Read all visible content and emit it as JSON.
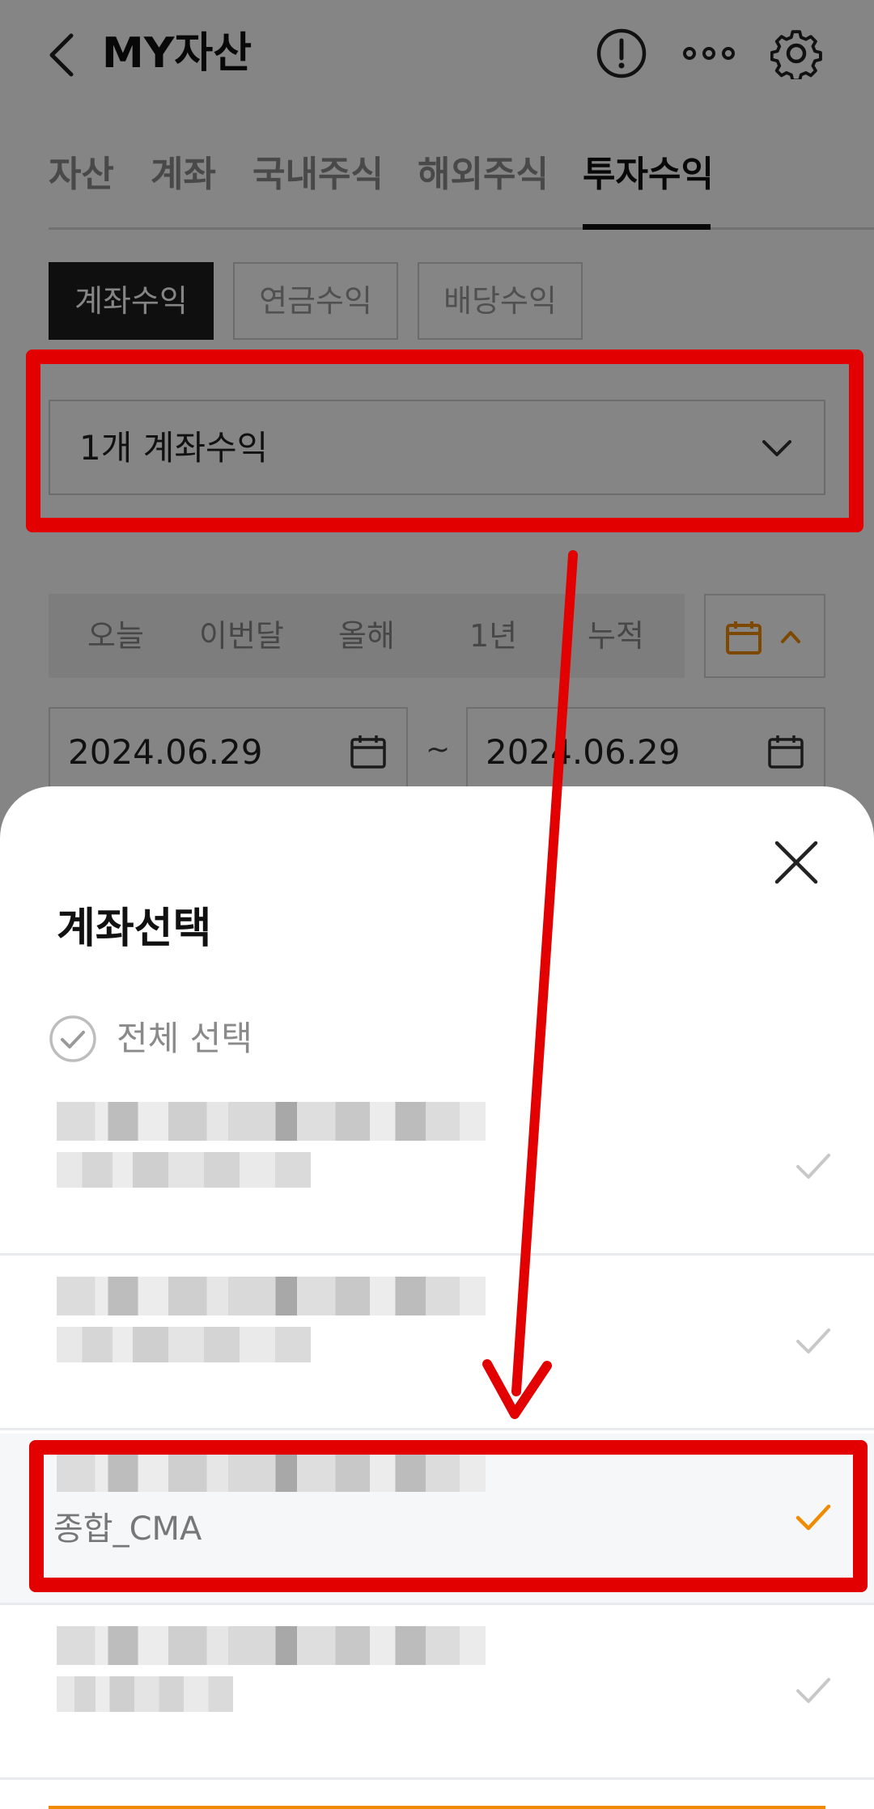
{
  "header": {
    "title": "MY자산"
  },
  "tabs": [
    "자산",
    "계좌",
    "국내주식",
    "해외주식",
    "투자수익"
  ],
  "sub_tabs": [
    "계좌수익",
    "연금수익",
    "배당수익"
  ],
  "account_select": {
    "label": "1개 계좌수익"
  },
  "periods": [
    "오늘",
    "이번달",
    "올해",
    "1년",
    "누적"
  ],
  "date_range": {
    "start": "2024.06.29",
    "separator": "~",
    "end": "2024.06.29"
  },
  "sheet": {
    "title": "계좌선택",
    "select_all_label": "전체 선택",
    "accounts": [
      {
        "name": "",
        "selected": false
      },
      {
        "name": "",
        "selected": false
      },
      {
        "name": "종합_CMA",
        "selected": true
      },
      {
        "name": "",
        "selected": false
      }
    ]
  },
  "colors": {
    "accent": "#f08a00",
    "annotation": "#e30000",
    "active_chip": "#1e1e1e",
    "dim_overlay": "rgba(0,0,0,0.48)"
  },
  "icons": [
    "back-arrow-icon",
    "alert-icon",
    "more-icon",
    "gear-icon",
    "chevron-down-icon",
    "calendar-icon",
    "chevron-up-icon",
    "close-icon",
    "check-circle-icon",
    "check-icon"
  ]
}
